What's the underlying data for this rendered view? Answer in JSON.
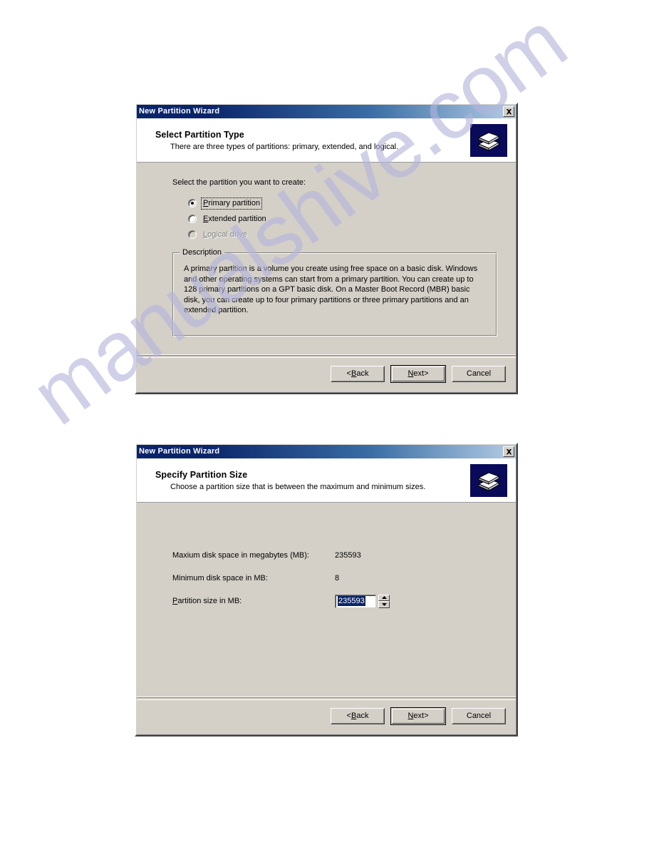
{
  "watermark": {
    "text": "manualshive.com"
  },
  "dialogs": [
    {
      "titlebar": {
        "title": "New Partition Wizard",
        "close_label": "x"
      },
      "header": {
        "title": "Select Partition Type",
        "subtitle": "There are three types of partitions: primary, extended, and logical.",
        "icon": "disk-stack-icon"
      },
      "body": {
        "prompt": "Select the partition you want to create:",
        "options": [
          {
            "label": "Primary partition",
            "accel": "P",
            "rest": "rimary partition",
            "checked": true,
            "disabled": false,
            "focused": true
          },
          {
            "label": "Extended partition",
            "accel": "E",
            "rest": "xtended partition",
            "checked": false,
            "disabled": false,
            "focused": false
          },
          {
            "label": "Logical drive",
            "accel": "L",
            "rest": "ogical drive",
            "checked": false,
            "disabled": true,
            "focused": false
          }
        ],
        "groupbox": {
          "title": "Description",
          "text": "A primary partition is a volume you create using free space on a basic disk. Windows and other operating systems can start from a primary partition. You can create up to 128 primary partitions on a GPT basic disk. On a Master Boot Record (MBR) basic disk, you can create up to four primary partitions or three primary partitions and an extended partition."
        }
      },
      "footer": {
        "buttons": [
          {
            "name": "back-button",
            "prefix": "< ",
            "accel": "B",
            "rest": "ack",
            "suffix": "",
            "default": false
          },
          {
            "name": "next-button",
            "prefix": "",
            "accel": "N",
            "rest": "ext",
            "suffix": " >",
            "default": true
          },
          {
            "name": "cancel-button",
            "prefix": "",
            "accel": "",
            "rest": "Cancel",
            "suffix": "",
            "default": false
          }
        ]
      }
    },
    {
      "titlebar": {
        "title": "New Partition Wizard",
        "close_label": "x"
      },
      "header": {
        "title": "Specify Partition Size",
        "subtitle": "Choose a partition size that is between the maximum and minimum sizes.",
        "icon": "disk-stack-icon"
      },
      "body": {
        "fields": [
          {
            "label": "Maxium disk space in megabytes (MB):",
            "value": "235593"
          },
          {
            "label": "Minimum disk space in MB:",
            "value": "8"
          }
        ],
        "size_field": {
          "label_accel": "P",
          "label_rest": "artition size in MB:",
          "value": "235593",
          "selected": true
        }
      },
      "footer": {
        "buttons": [
          {
            "name": "back-button",
            "prefix": "< ",
            "accel": "B",
            "rest": "ack",
            "suffix": "",
            "default": false
          },
          {
            "name": "next-button",
            "prefix": "",
            "accel": "N",
            "rest": "ext",
            "suffix": " >",
            "default": true
          },
          {
            "name": "cancel-button",
            "prefix": "",
            "accel": "",
            "rest": "Cancel",
            "suffix": "",
            "default": false
          }
        ]
      }
    }
  ]
}
